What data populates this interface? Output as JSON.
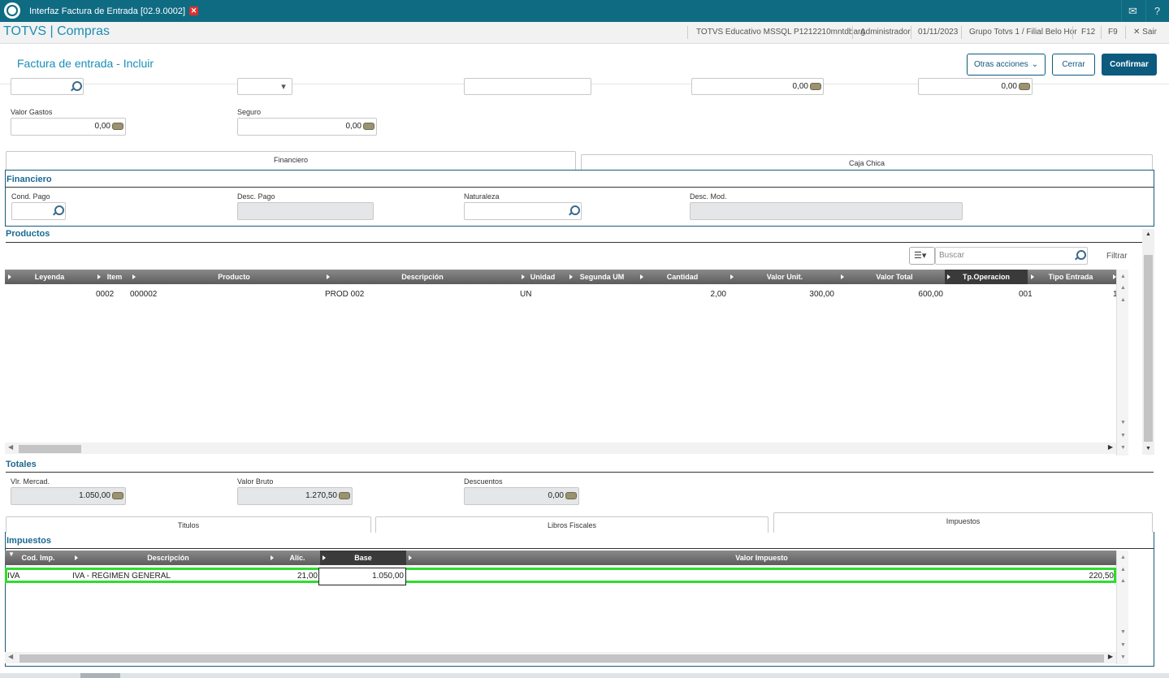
{
  "window": {
    "tab_title": "Interfaz Factura de Entrada [02.9.0002]"
  },
  "header": {
    "app_title": "TOTVS | Compras",
    "environment": "TOTVS Educativo MSSQL P1212210mntdbarg",
    "user": "Administrador",
    "date": "01/11/2023",
    "branch": "Grupo Totvs 1 / Filial Belo Hor",
    "f12": "F12",
    "f9": "F9",
    "exit": "Sair"
  },
  "page": {
    "title": "Factura de entrada - Incluir",
    "other_actions": "Otras acciones",
    "close": "Cerrar",
    "confirm": "Confirmar"
  },
  "top_fields": {
    "row1_val_a": "0,00",
    "row1_val_b": "0,00",
    "valor_gastos_label": "Valor Gastos",
    "valor_gastos": "0,00",
    "seguro_label": "Seguro",
    "seguro": "0,00"
  },
  "fin_tabs": {
    "financiero": "Financiero",
    "caja_chica": "Caja Chica"
  },
  "financiero": {
    "title": "Financiero",
    "cond_pago_label": "Cond. Pago",
    "desc_pago_label": "Desc. Pago",
    "naturaleza_label": "Naturaleza",
    "desc_mod_label": "Desc. Mod."
  },
  "productos": {
    "title": "Productos",
    "search_placeholder": "Buscar",
    "filter": "Filtrar",
    "columns": [
      "Leyenda",
      "Item",
      "Producto",
      "Descripción",
      "Unidad",
      "Segunda UM",
      "Cantidad",
      "Valor Unit.",
      "Valor Total",
      "Tp.Operacion",
      "Tipo Entrada"
    ],
    "rows": [
      {
        "leyenda": "",
        "item": "0002",
        "producto": "000002",
        "descripcion": "PROD 002",
        "unidad": "UN",
        "segunda_um": "",
        "cantidad": "2,00",
        "valor_unit": "300,00",
        "valor_total": "600,00",
        "tp_operacion": "",
        "tipo_entrada": "001",
        "extra": "1"
      }
    ]
  },
  "totales": {
    "title": "Totales",
    "vlr_mercad_label": "Vlr. Mercad.",
    "vlr_mercad": "1.050,00",
    "valor_bruto_label": "Valor Bruto",
    "valor_bruto": "1.270,50",
    "descuentos_label": "Descuentos",
    "descuentos": "0,00"
  },
  "bottom_tabs": {
    "titulos": "Titulos",
    "libros": "Libros Fiscales",
    "impuestos": "Impuestos"
  },
  "impuestos": {
    "title": "Impuestos",
    "columns": [
      "Cod. Imp.",
      "Descripción",
      "Alic.",
      "Base",
      "Valor Impuesto"
    ],
    "rows": [
      {
        "cod": "IVA",
        "descripcion": "IVA - REGIMEN GENERAL",
        "alic": "21,00",
        "base": "1.050,00",
        "valor": "220,50"
      }
    ]
  }
}
